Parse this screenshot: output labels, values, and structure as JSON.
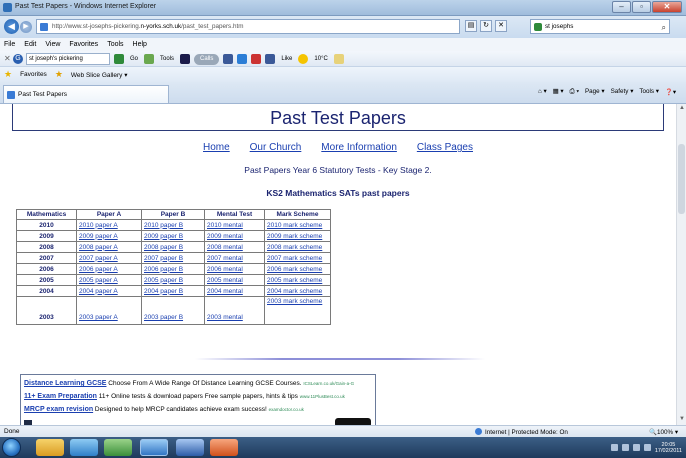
{
  "window": {
    "title": "Past Test Papers - Windows Internet Explorer",
    "buttons": [
      "–",
      "▫",
      "✕"
    ]
  },
  "address_bar": {
    "url_prefix": "http://www.st-josephs-pickering.",
    "url_domain": "n-yorks.sch.uk",
    "url_path": "/past_test_papers.htm",
    "search_text": "st josephs"
  },
  "menu": [
    "File",
    "Edit",
    "View",
    "Favorites",
    "Tools",
    "Help"
  ],
  "toolbar": {
    "search_value": "st joseph's pickering",
    "items": [
      "Go",
      "Tools",
      "Calls",
      "Like",
      "10°C"
    ]
  },
  "favorites_bar": {
    "favorites_label": "Favorites",
    "web_slice_label": "Web Slice Gallery ▾"
  },
  "tab": {
    "label": "Past Test Papers",
    "tools": [
      "Page ▾",
      "Safety ▾",
      "Tools ▾"
    ]
  },
  "page": {
    "title": "Past Test Papers",
    "nav": [
      "Home",
      "Our Church",
      "More Information",
      "Class Pages"
    ],
    "subtitle": "Past Papers Year 6 Statutory Tests - Key Stage 2.",
    "section_heading": "KS2 Mathematics SATs past papers",
    "table": {
      "headers": [
        "Mathematics",
        "Paper A",
        "Paper B",
        "Mental Test",
        "Mark Scheme"
      ],
      "rows": [
        {
          "year": "2010",
          "a": "2010 paper A",
          "b": "2010 paper B",
          "mental": "2010 mental",
          "scheme": "2010 mark scheme"
        },
        {
          "year": "2009",
          "a": "2009 paper A",
          "b": "2009 paper B",
          "mental": "2009 mental",
          "scheme": "2009 mark scheme"
        },
        {
          "year": "2008",
          "a": "2008 paper A",
          "b": "2008 paper B",
          "mental": "2008 mental",
          "scheme": "2008 mark scheme"
        },
        {
          "year": "2007",
          "a": "2007 paper A",
          "b": "2007 paper B",
          "mental": "2007 mental",
          "scheme": "2007 mark scheme"
        },
        {
          "year": "2006",
          "a": "2006 paper A",
          "b": "2006 paper B",
          "mental": "2006 mental",
          "scheme": "2006 mark scheme"
        },
        {
          "year": "2005",
          "a": "2005 paper A",
          "b": "2005 paper B",
          "mental": "2005 mental",
          "scheme": "2005 mark scheme"
        },
        {
          "year": "2004",
          "a": "2004 paper A",
          "b": "2004 paper B",
          "mental": "2004 mental",
          "scheme": "2004 mark scheme"
        },
        {
          "year": "2003",
          "a": "2003 paper A",
          "b": "2003 paper B",
          "mental": "2003 mental",
          "scheme": "2003 mark scheme"
        }
      ]
    },
    "ads": [
      {
        "link": "Distance Learning GCSE",
        "text": " Choose From A Wide Range Of Distance Learning GCSE Courses.",
        "source": "ICSLearn.co.uk/Gain-a-G"
      },
      {
        "link": "11+ Exam Preparation",
        "text": " 11+ Online tests & download papers Free sample papers, hints & tips",
        "source": "www.11PlusBest.co.uk"
      },
      {
        "link": "MRCP exam revision",
        "text": " Designed to help MRCP candidates achieve exam success!",
        "source": "examdoctor.co.uk"
      }
    ]
  },
  "status_bar": {
    "left": "Done",
    "zone": "Internet | Protected Mode: On",
    "zoom": "🔍100% ▾"
  },
  "taskbar": {
    "time": "20:05",
    "date": "17/02/2011"
  },
  "colors": {
    "heading_blue": "#1b2470",
    "link_blue": "#1a3fb0",
    "taskbar": "#2a4a6e"
  }
}
